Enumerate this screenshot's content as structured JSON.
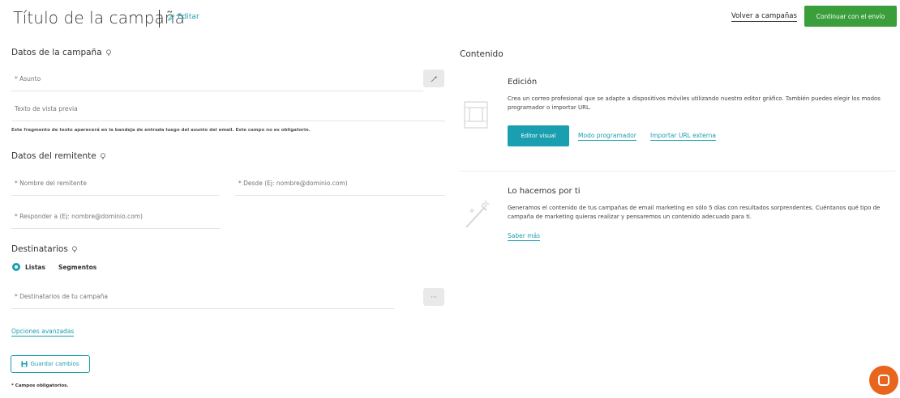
{
  "header": {
    "title": "Título de la campaña",
    "edit_label": "Editar",
    "back_label": "Volver a campañas",
    "continue_label": "Continuar con el envío"
  },
  "campaign": {
    "section_title": "Datos de la campaña",
    "subject_placeholder": "* Asunto",
    "preview_placeholder": "Texto de vista previa",
    "preview_help": "Este fragmento de texto aparecerá en la bandeja de entrada luego del asunto del email. Este campo no es obligatorio."
  },
  "sender": {
    "section_title": "Datos del remitente",
    "name_placeholder": "* Nombre del remitente",
    "from_placeholder": "* Desde (Ej: nombre@dominio.com)",
    "reply_placeholder": "* Responder a (Ej: nombre@dominio.com)"
  },
  "recipients": {
    "section_title": "Destinatarios",
    "option_lists": "Listas",
    "option_segments": "Segmentos",
    "recipients_placeholder": "* Destinatarios de tu campaña",
    "more_button": "···"
  },
  "advanced_label": "Opciones avanzadas",
  "save_label": "Guardar cambios",
  "required_note": "* Campos obligatorios.",
  "content": {
    "section_title": "Contenido",
    "edition": {
      "title": "Edición",
      "description": "Crea un correo profesional que se adapte a dispositivos móviles utilizando nuestro editor gráfico. También puedes elegir los modos programador o importar URL.",
      "visual_button": "Editor visual",
      "programmer_link": "Modo programador",
      "import_link": "Importar URL externa"
    },
    "done_for_you": {
      "title": "Lo hacemos por ti",
      "description": "Generamos el contenido de tus campañas de email marketing en sólo 5 días con resultados sorprendentes. Cuéntanos qué tipo de campaña de marketing quieras realizar y pensaremos un contenido adecuado para ti.",
      "more_link": "Saber más"
    }
  }
}
